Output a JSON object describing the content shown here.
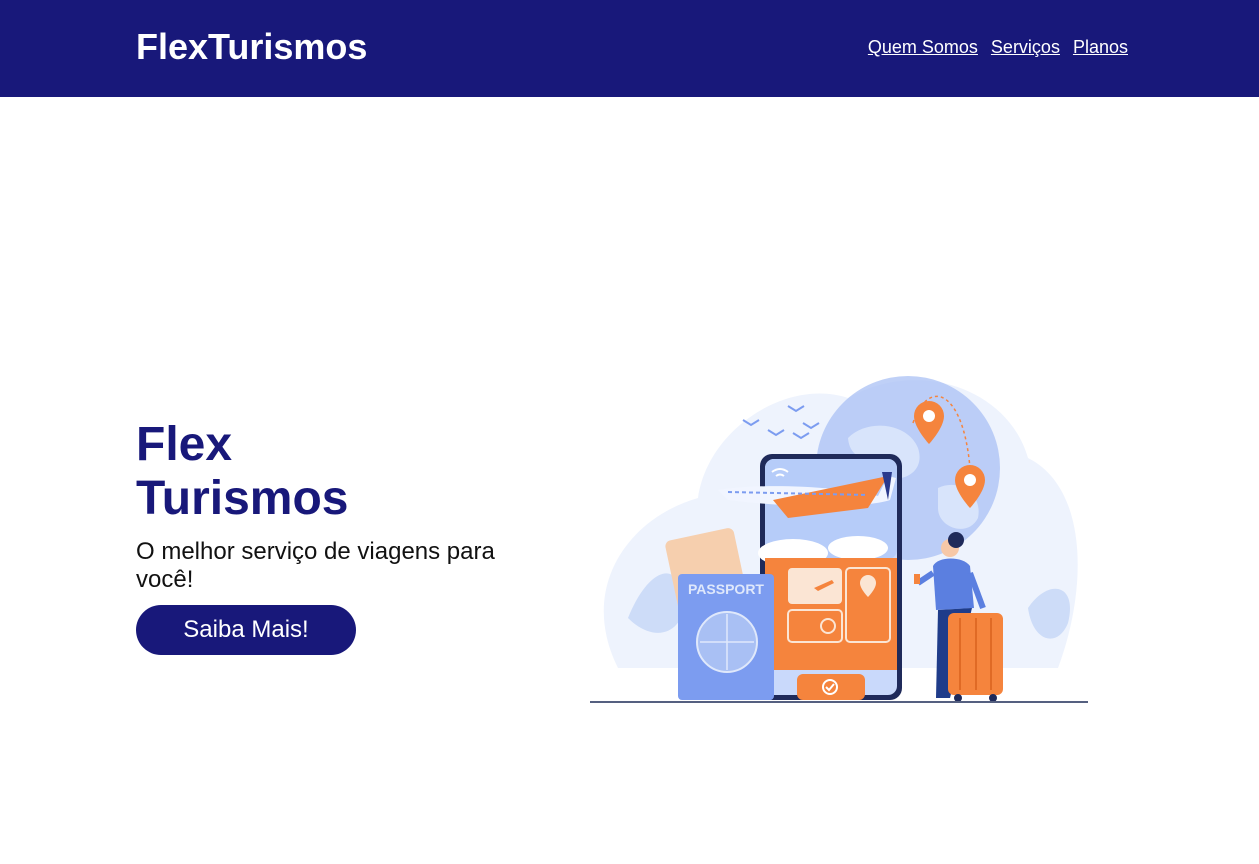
{
  "header": {
    "brand": "FlexTurismos",
    "nav": [
      {
        "label": "Quem Somos"
      },
      {
        "label": "Serviços"
      },
      {
        "label": "Planos"
      }
    ]
  },
  "hero": {
    "title": "Flex Turismos",
    "subtitle": "O melhor serviço de viagens para você!",
    "cta_label": "Saiba Mais!"
  },
  "illustration": {
    "passport_label": "PASSPORT"
  },
  "colors": {
    "header_bg": "#18187a",
    "accent_orange": "#f5843d",
    "accent_blue": "#7c9cf0",
    "light_blue": "#dfe8fb"
  }
}
